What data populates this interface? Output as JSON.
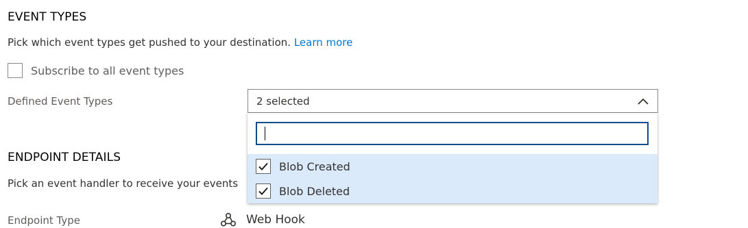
{
  "event_types": {
    "title": "EVENT TYPES",
    "description": "Pick which event types get pushed to your destination.",
    "learn_more": "Learn more",
    "subscribe_all_label": "Subscribe to all event types",
    "subscribe_all_checked": false,
    "defined_label": "Defined Event Types",
    "dropdown_value": "2 selected",
    "filter_value": "",
    "options": [
      {
        "label": "Blob Created",
        "checked": true
      },
      {
        "label": "Blob Deleted",
        "checked": true
      }
    ]
  },
  "endpoint": {
    "title": "ENDPOINT DETAILS",
    "description": "Pick an event handler to receive your events",
    "type_label": "Endpoint Type",
    "type_value": "Web Hook",
    "type_icon": "webhook-icon"
  },
  "colors": {
    "link": "#0078d4",
    "selected_bg": "#dbeafb",
    "focus_border": "#0f4d8a"
  }
}
